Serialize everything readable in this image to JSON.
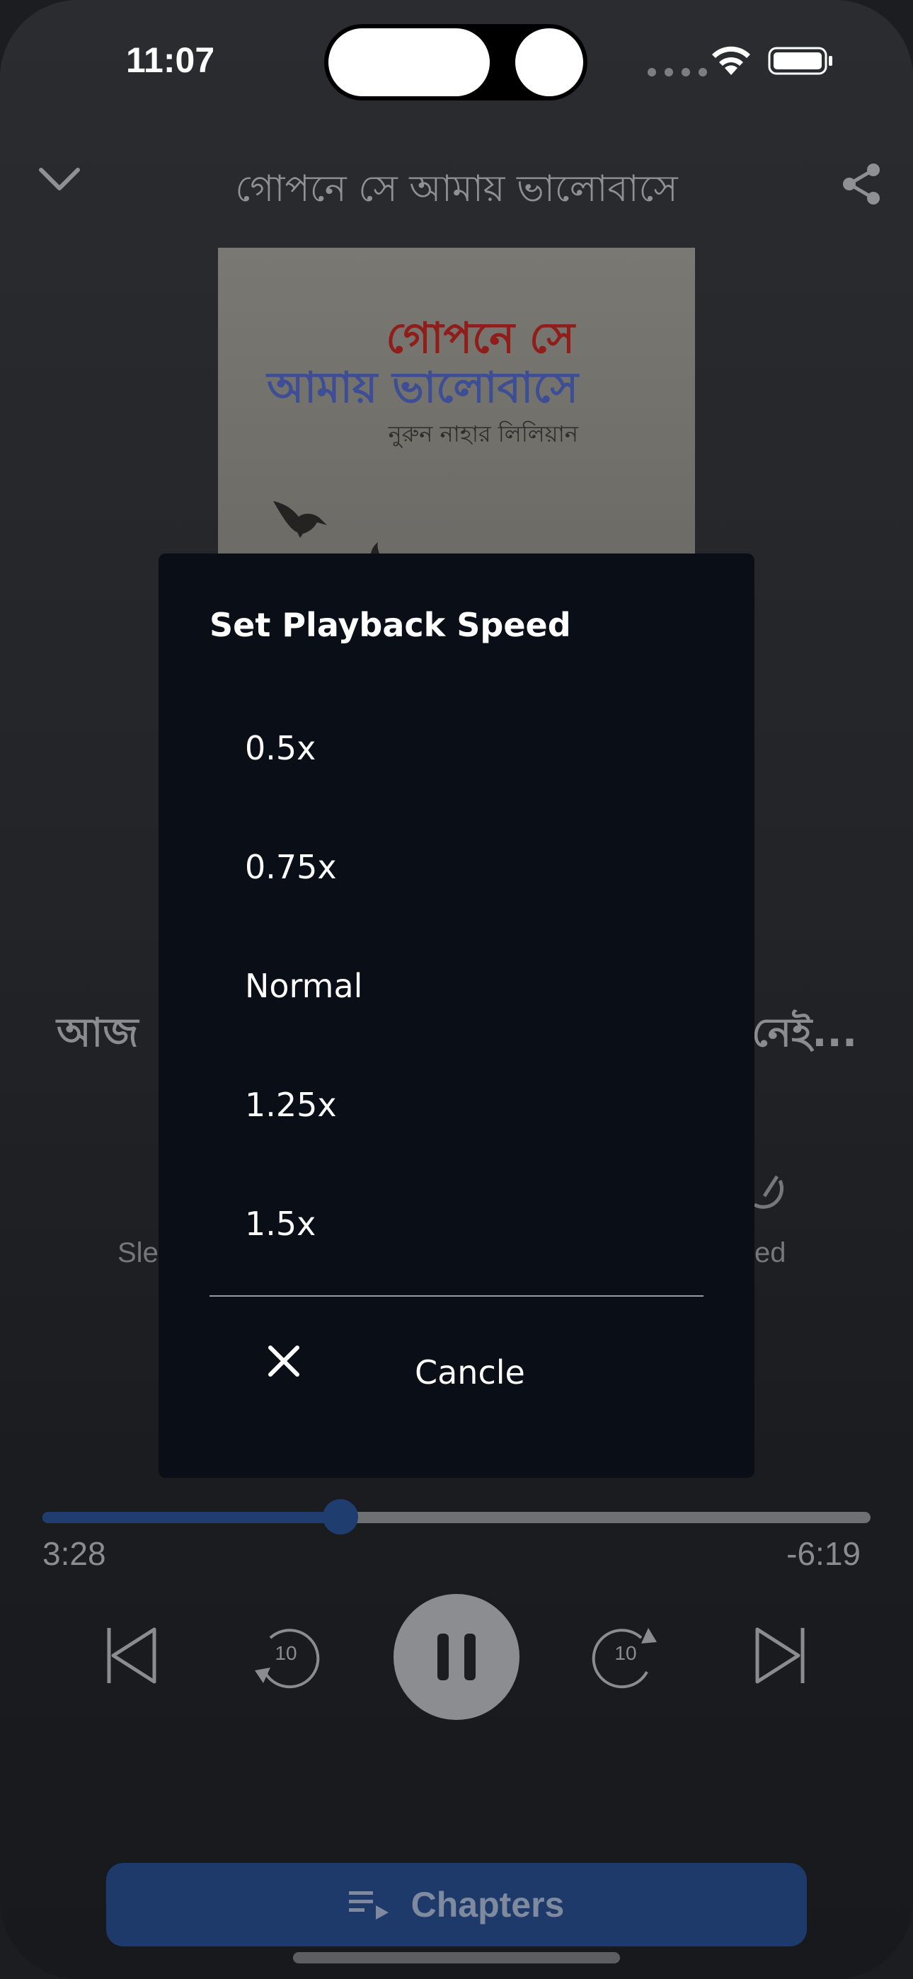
{
  "status_bar": {
    "time": "11:07"
  },
  "header": {
    "title": "গোপনে সে আমায় ভালোবাসে"
  },
  "cover": {
    "line1": "গোপনে সে",
    "line2": "আমায় ভালোবাসে",
    "author": "নুরুন নাহার লিলিয়ান"
  },
  "background": {
    "subtitle_left": "আজ",
    "subtitle_right": "নেই...",
    "label_left": "Sle",
    "label_right": "ed"
  },
  "player": {
    "elapsed": "3:28",
    "remaining": "-6:19",
    "progress_fraction": 0.36,
    "rewind_seconds": "10",
    "forward_seconds": "10"
  },
  "chapters_button": {
    "label": "Chapters"
  },
  "modal": {
    "title": "Set Playback Speed",
    "options": [
      "0.5x",
      "0.75x",
      "Normal",
      "1.25x",
      "1.5x"
    ],
    "cancel_label": "Cancle"
  },
  "colors": {
    "accent": "#1f3d6e",
    "modal_bg": "#0a0e16"
  }
}
